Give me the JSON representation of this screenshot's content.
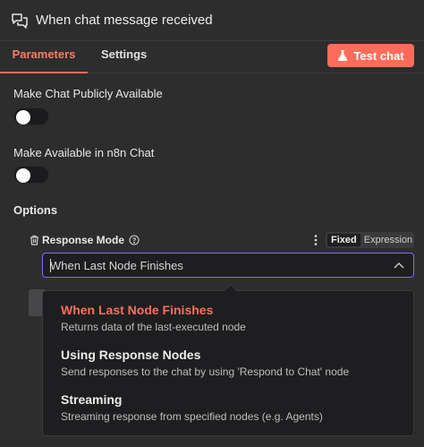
{
  "header": {
    "title": "When chat message received",
    "icon": "chat-bubbles-icon"
  },
  "tabs": [
    {
      "label": "Parameters",
      "active": true
    },
    {
      "label": "Settings",
      "active": false
    }
  ],
  "test_button": {
    "label": "Test chat",
    "icon": "flask-icon"
  },
  "fields": {
    "public": {
      "label": "Make Chat Publicly Available",
      "enabled": false
    },
    "n8n_chat": {
      "label": "Make Available in n8n Chat",
      "enabled": false
    }
  },
  "options": {
    "title": "Options",
    "response_mode": {
      "label": "Response Mode",
      "mode_toggle": {
        "fixed": "Fixed",
        "expression": "Expression",
        "active": "Fixed"
      },
      "value": "When Last Node Finishes",
      "choices": [
        {
          "title": "When Last Node Finishes",
          "desc": "Returns data of the last-executed node",
          "selected": true
        },
        {
          "title": "Using Response Nodes",
          "desc": "Send responses to the chat by using 'Respond to Chat' node",
          "selected": false
        },
        {
          "title": "Streaming",
          "desc": "Streaming response from specified nodes (e.g. Agents)",
          "selected": false
        }
      ]
    }
  },
  "colors": {
    "accent": "#ff6d5a",
    "focus_border": "#7b6cff",
    "background": "#2d2d2e"
  }
}
